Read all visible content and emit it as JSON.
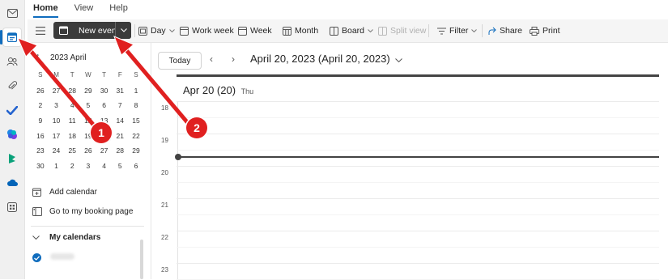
{
  "tabs": [
    "Home",
    "View",
    "Help"
  ],
  "toolbar": {
    "new_event": "New event",
    "day": "Day",
    "work_week": "Work week",
    "week": "Week",
    "month": "Month",
    "board": "Board",
    "split_view": "Split view",
    "filter": "Filter",
    "share": "Share",
    "print": "Print"
  },
  "mini_calendar": {
    "title": "2023 April",
    "weekdays": [
      "S",
      "M",
      "T",
      "W",
      "T",
      "F",
      "S"
    ],
    "weeks": [
      [
        "26",
        "27",
        "28",
        "29",
        "30",
        "31",
        "1"
      ],
      [
        "2",
        "3",
        "4",
        "5",
        "6",
        "7",
        "8"
      ],
      [
        "9",
        "10",
        "11",
        "12",
        "13",
        "14",
        "15"
      ],
      [
        "16",
        "17",
        "18",
        "19",
        "20",
        "21",
        "22"
      ],
      [
        "23",
        "24",
        "25",
        "26",
        "27",
        "28",
        "29"
      ],
      [
        "30",
        "1",
        "2",
        "3",
        "4",
        "5",
        "6"
      ]
    ],
    "selected": "20"
  },
  "left_pane": {
    "add_calendar": "Add calendar",
    "booking_page": "Go to my booking page",
    "my_calendars": "My calendars"
  },
  "calendar": {
    "today_button": "Today",
    "date_title": "April 20, 2023  (April 20, 2023)",
    "day_header": "Apr 20 (20)",
    "day_name": "Thu",
    "hours": [
      "18",
      "19",
      "20",
      "21",
      "22",
      "23"
    ]
  },
  "annotations": {
    "badge_1": "1",
    "badge_2": "2",
    "color": "#e02020"
  },
  "colors": {
    "accent": "#0f6cbd",
    "new_event_bg": "#3b3b3b"
  }
}
